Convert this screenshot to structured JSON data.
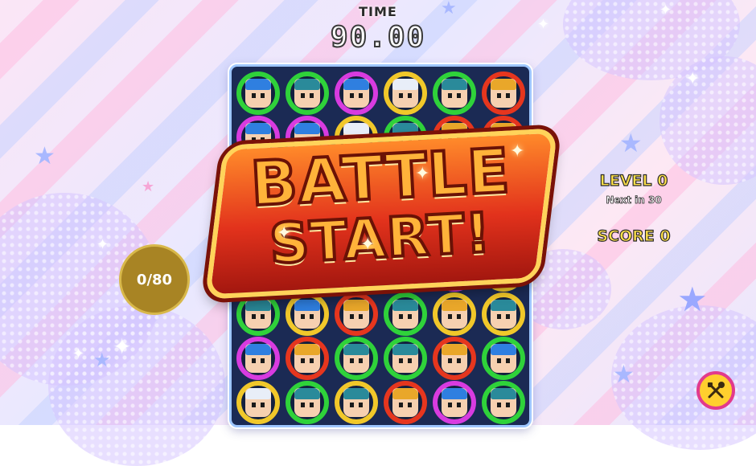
{
  "hud": {
    "time_label": "TIME",
    "time_value": "90.00",
    "counter": "0/80",
    "level_label": "LEVEL 0",
    "next_label": "Next in 30",
    "score_label": "SCORE 0"
  },
  "banner": {
    "line1": "BATTLE",
    "line2": "START!"
  },
  "menu": {
    "icon": "tools-icon"
  },
  "colors": {
    "green_ring": "#2fd23a",
    "magenta_ring": "#d83be0",
    "yellow_ring": "#f1c82a",
    "red_ring": "#e6361e",
    "board_bg": "#1b2a54",
    "banner_red": "#e2321c",
    "level_yellow": "#ffe14a",
    "counter_gold": "#a88424"
  },
  "board": {
    "columns": 6,
    "rows": 8,
    "tiles": [
      [
        "green",
        "green",
        "magenta",
        "yellow",
        "green",
        "red"
      ],
      [
        "magenta",
        "magenta",
        "yellow",
        "green",
        "red",
        "red"
      ],
      [
        "green",
        "red",
        "green",
        "magenta",
        "yellow",
        "red"
      ],
      [
        "yellow",
        "green",
        "red",
        "green",
        "magenta",
        "green"
      ],
      [
        "red",
        "yellow",
        "yellow",
        "green",
        "magenta",
        "yellow"
      ],
      [
        "green",
        "yellow",
        "red",
        "green",
        "yellow",
        "yellow"
      ],
      [
        "magenta",
        "red",
        "green",
        "green",
        "red",
        "green"
      ],
      [
        "yellow",
        "green",
        "yellow",
        "red",
        "magenta",
        "green"
      ]
    ],
    "characters": [
      [
        "blue",
        "teal",
        "blue",
        "white",
        "teal",
        "gold"
      ],
      [
        "blue",
        "blue",
        "white",
        "teal",
        "gold",
        "gold"
      ],
      [
        "blue",
        "gold",
        "blue",
        "blue",
        "white",
        "gold"
      ],
      [
        "white",
        "teal",
        "gold",
        "teal",
        "blue",
        "teal"
      ],
      [
        "gold",
        "blue",
        "teal",
        "blue",
        "white",
        "white"
      ],
      [
        "teal",
        "blue",
        "gold",
        "teal",
        "gold",
        "teal"
      ],
      [
        "blue",
        "gold",
        "teal",
        "teal",
        "gold",
        "blue"
      ],
      [
        "white",
        "teal",
        "teal",
        "gold",
        "blue",
        "teal"
      ]
    ]
  }
}
